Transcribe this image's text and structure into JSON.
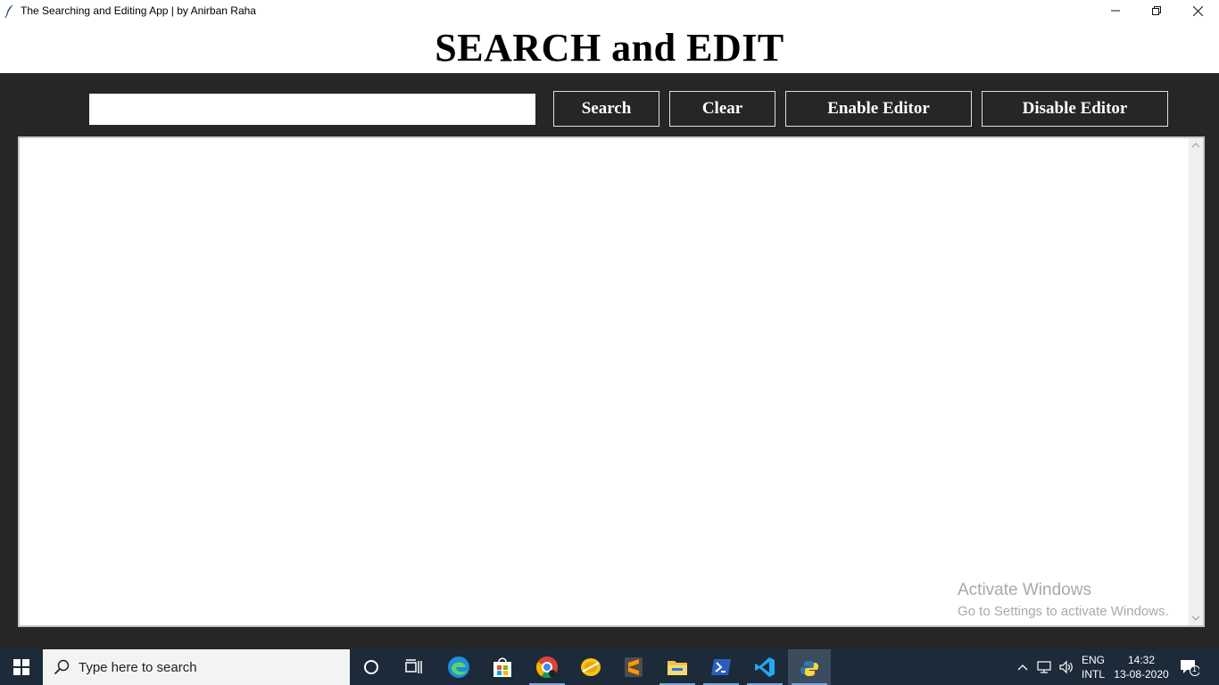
{
  "window": {
    "title": "The Searching and Editing App | by Anirban Raha",
    "icon": "feather-icon"
  },
  "heading": "SEARCH and EDIT",
  "search": {
    "value": "",
    "placeholder": ""
  },
  "buttons": {
    "search": "Search",
    "clear": "Clear",
    "enable_editor": "Enable Editor",
    "disable_editor": "Disable Editor"
  },
  "editor": {
    "content": ""
  },
  "watermark": {
    "line1": "Activate Windows",
    "line2": "Go to Settings to activate Windows."
  },
  "taskbar": {
    "search_placeholder": "Type here to search",
    "apps": [
      "cortana-icon",
      "task-view-icon",
      "edge-icon",
      "store-icon",
      "chrome-icon",
      "coin-icon",
      "sublime-icon",
      "file-explorer-icon",
      "powershell-icon",
      "vscode-icon",
      "python-icon"
    ],
    "language": {
      "line1": "ENG",
      "line2": "INTL"
    },
    "time": "14:32",
    "date": "13-08-2020",
    "notifications": "1"
  },
  "colors": {
    "app_background": "#262626",
    "taskbar": "#1c2a3a",
    "button_text": "#ffffff"
  }
}
